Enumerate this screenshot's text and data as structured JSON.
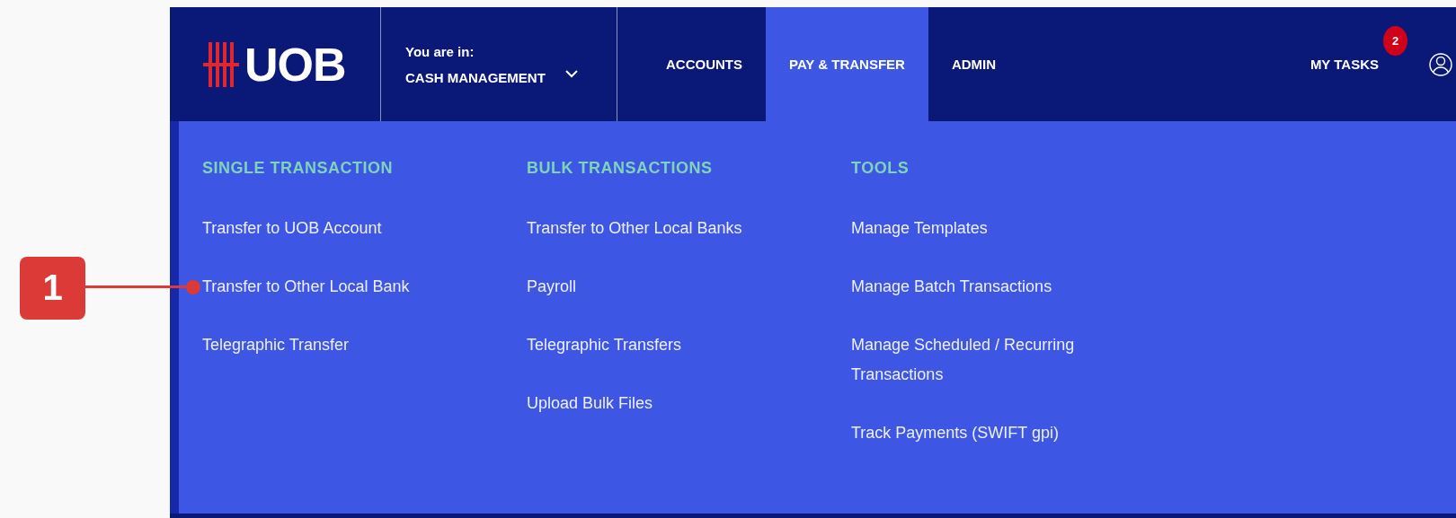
{
  "header": {
    "logo": "UOB",
    "location": {
      "label": "You are in:",
      "value": "CASH MANAGEMENT"
    },
    "nav": [
      {
        "label": "ACCOUNTS",
        "selected": false
      },
      {
        "label": "PAY & TRANSFER",
        "selected": true
      },
      {
        "label": "ADMIN",
        "selected": false
      }
    ],
    "tasks": {
      "label": "MY TASKS",
      "badge": "2"
    }
  },
  "menu": {
    "columns": [
      {
        "heading": "SINGLE TRANSACTION",
        "items": [
          {
            "label": "Transfer to UOB Account",
            "callout": false
          },
          {
            "label": "Transfer to Other Local Bank",
            "callout": true
          },
          {
            "label": "Telegraphic Transfer",
            "callout": false
          }
        ]
      },
      {
        "heading": "BULK TRANSACTIONS",
        "items": [
          {
            "label": "Transfer to Other Local Banks",
            "callout": false
          },
          {
            "label": "Payroll",
            "callout": false
          },
          {
            "label": "Telegraphic Transfers",
            "callout": false
          },
          {
            "label": "Upload Bulk Files",
            "callout": false
          }
        ]
      },
      {
        "heading": "TOOLS",
        "items": [
          {
            "label": "Manage Templates",
            "callout": false
          },
          {
            "label": "Manage Batch Transactions",
            "callout": false
          },
          {
            "label": "Manage Scheduled / Recurring Transactions",
            "callout": false
          },
          {
            "label": "Track Payments (SWIFT gpi)",
            "callout": false
          }
        ]
      }
    ]
  },
  "callout": {
    "number": "1"
  }
}
